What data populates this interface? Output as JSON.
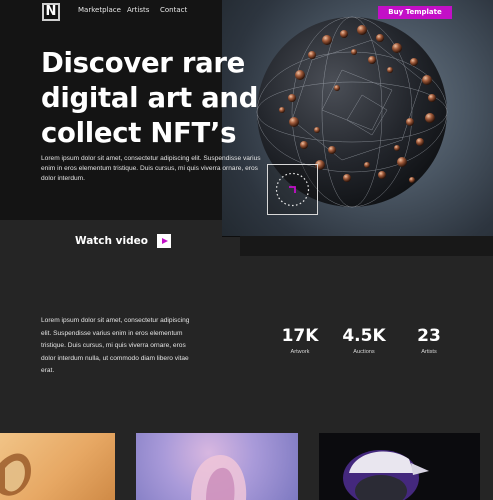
{
  "nav": {
    "logo_letter": "N",
    "links": [
      "Marketplace",
      "Artists",
      "Contact"
    ],
    "cta_label": "Buy Template"
  },
  "hero": {
    "title": "Discover rare digital art and collect NFT’s",
    "description": "Lorem ipsum dolor sit amet, consectetur adipiscing elit. Suspendisse varius enim in eros elementum tristique. Duis cursus, mi quis viverra ornare, eros dolor interdum.",
    "watch_label": "Watch video"
  },
  "stats": {
    "description": "Lorem ipsum dolor sit amet, consectetur adipiscing elit. Suspendisse varius enim in eros elementum tristique. Duis cursus, mi quis viverra ornare, eros dolor interdum nulla, ut commodo diam libero vitae erat.",
    "items": [
      {
        "value": "17K",
        "label": "Artwork"
      },
      {
        "value": "4.5K",
        "label": "Auctions"
      },
      {
        "value": "23",
        "label": "Artists"
      }
    ]
  },
  "colors": {
    "accent": "#c30fc7",
    "background": "#252525",
    "hero_background": "#141414"
  },
  "icons": [
    "play-icon",
    "rotating-seal-icon"
  ]
}
